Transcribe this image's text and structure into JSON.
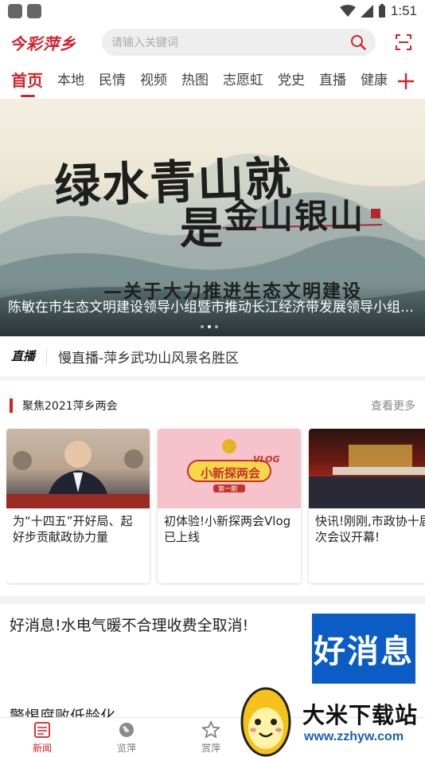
{
  "status_bar": {
    "time": "1:51"
  },
  "header": {
    "logo": "今彩萍乡",
    "search_placeholder": "请输入关键词"
  },
  "tabs": [
    "首页",
    "本地",
    "民情",
    "视频",
    "热图",
    "志愿虹",
    "党史",
    "直播",
    "健康"
  ],
  "banner": {
    "art_line1": "绿水青山就",
    "art_line2": "是",
    "art_line3": "金山银山",
    "art_subtitle": "—关于大力推进生态文明建设",
    "caption": "陈敏在市生态文明建设领导小组暨市推动长江经济带发展领导小组会议上强调"
  },
  "live": {
    "tag": "直播",
    "text": "慢直播-萍乡武功山风景名胜区"
  },
  "section": {
    "title": "聚焦2021萍乡两会",
    "more": "查看更多",
    "cards": [
      {
        "title": "为“十四五”开好局、起好步贡献政协力量"
      },
      {
        "title": "初体验!小新探两会Vlog已上线",
        "img_text": "小新探两会",
        "img_sub": "第一期",
        "img_tag": "VLOG"
      },
      {
        "title": "快讯!刚刚,市政协十届六次会议开幕!"
      }
    ]
  },
  "news": [
    {
      "title": "好消息!水电气暖不合理收费全取消!",
      "thumb_text": "好消息"
    },
    {
      "title": "警惕腐败低龄化"
    }
  ],
  "bottom_nav": [
    {
      "label": "新闻",
      "icon": "news-icon",
      "active": true
    },
    {
      "label": "览萍",
      "icon": "globe-icon",
      "active": false
    },
    {
      "label": "赏萍",
      "icon": "star-icon",
      "active": false
    }
  ],
  "watermark": {
    "text": "大米下载站",
    "url": "www.zzhyw.com"
  },
  "colors": {
    "accent": "#d2232a",
    "blue": "#0b5cc4"
  }
}
